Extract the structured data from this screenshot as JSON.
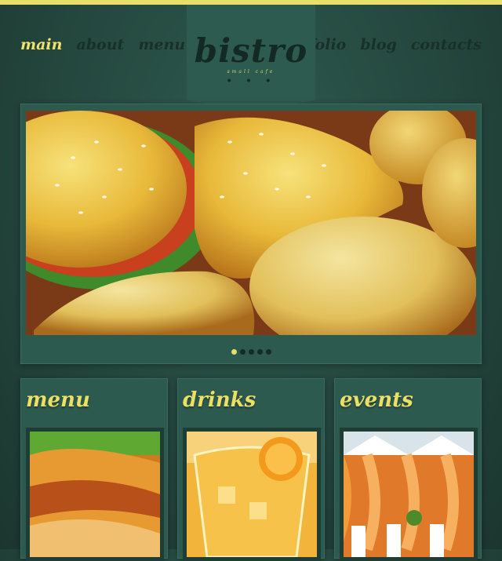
{
  "nav": {
    "left": [
      {
        "label": "main",
        "active": true
      },
      {
        "label": "about",
        "active": false
      },
      {
        "label": "menu",
        "active": false
      }
    ],
    "right": [
      {
        "label": "folio",
        "active": false
      },
      {
        "label": "blog",
        "active": false
      },
      {
        "label": "contacts",
        "active": false
      }
    ]
  },
  "logo": {
    "title": "bistro",
    "subtitle": "small cafe",
    "dots": "• • •"
  },
  "slider": {
    "slide_count": 5,
    "active_index": 0
  },
  "panels": [
    {
      "title": "menu"
    },
    {
      "title": "drinks"
    },
    {
      "title": "events"
    }
  ],
  "colors": {
    "accent": "#e8de6a",
    "background": "#24473e",
    "panel": "#2d5a4f",
    "dark_text": "#173028"
  }
}
